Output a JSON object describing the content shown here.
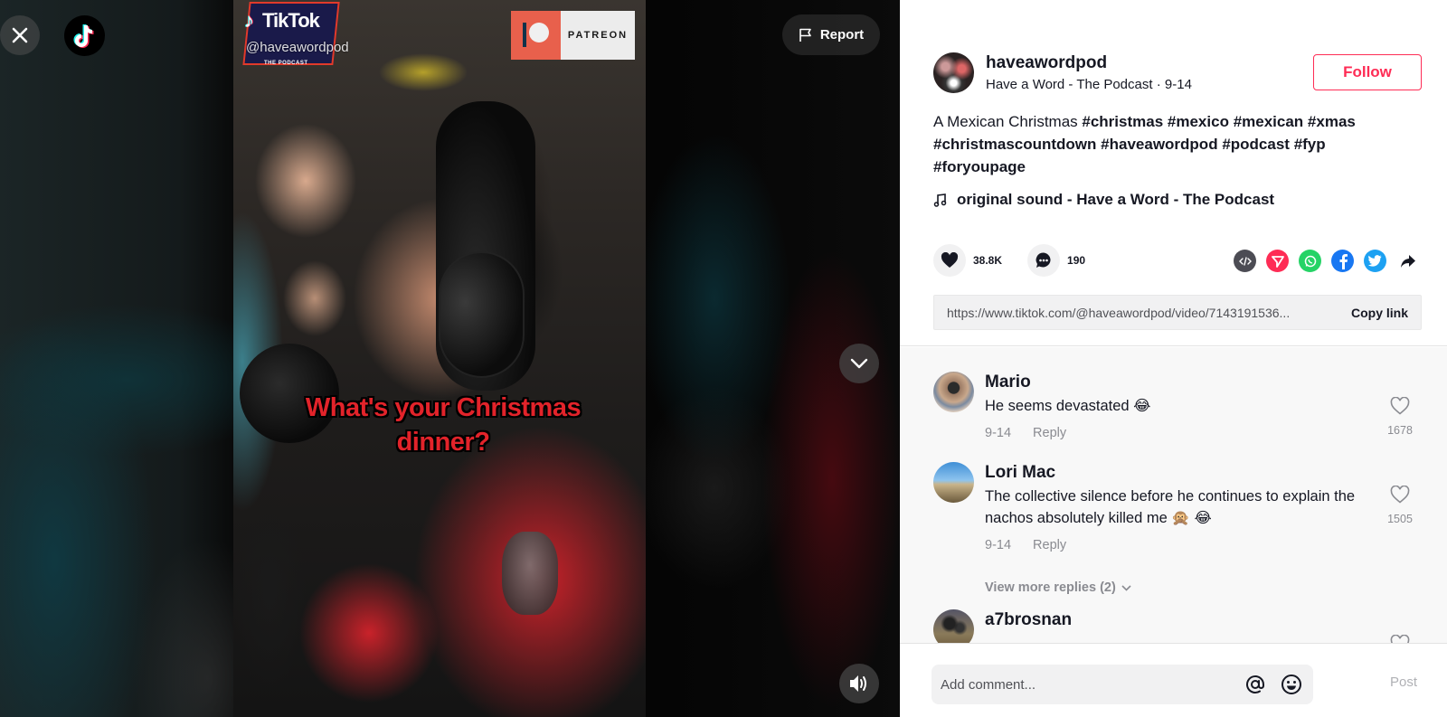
{
  "player": {
    "caption_line1": "What's your Christmas",
    "caption_line2": "dinner?",
    "watermark_brand": "TikTok",
    "watermark_handle": "@haveawordpod",
    "watermark_sub": "THE PODCAST",
    "patreon_label": "PATREON",
    "report_label": "Report",
    "icons": {
      "close": "close-icon",
      "logo": "tiktok-logo-icon",
      "report": "flag-icon",
      "next": "chevron-down-icon",
      "volume": "volume-icon"
    }
  },
  "author": {
    "username": "haveawordpod",
    "nickname": "Have a Word - The Podcast",
    "separator": " · ",
    "date": "9-14",
    "follow_label": "Follow"
  },
  "description": {
    "text": "A Mexican Christmas ",
    "hashtags": [
      "#christmas",
      "#mexico",
      "#mexican",
      "#xmas",
      "#christmascountdown",
      "#haveawordpod",
      "#podcast",
      "#fyp",
      "#foryoupage"
    ]
  },
  "music": {
    "icon": "music-note-icon",
    "title": "original sound - Have a Word - The Podcast"
  },
  "stats": {
    "likes": "38.8K",
    "comments": "190"
  },
  "share": {
    "targets": [
      {
        "name": "embed",
        "color": "#4c4c54"
      },
      {
        "name": "send-to-friends",
        "color": "#fe2c55"
      },
      {
        "name": "whatsapp",
        "color": "#25d366"
      },
      {
        "name": "facebook",
        "color": "#1877f2"
      },
      {
        "name": "twitter",
        "color": "#1da1f2"
      },
      {
        "name": "more",
        "color": "#161823"
      }
    ],
    "link_url": "https://www.tiktok.com/@haveawordpod/video/7143191536...",
    "copy_label": "Copy link"
  },
  "comments": [
    {
      "user": "Mario",
      "text": "He seems devastated 😂",
      "date": "9-14",
      "reply_label": "Reply",
      "likes": "1678"
    },
    {
      "user": "Lori Mac",
      "text": "The collective silence before he continues to explain the nachos absolutely killed me 🙊 😂",
      "date": "9-14",
      "reply_label": "Reply",
      "likes": "1505",
      "view_more": "View more replies (2)"
    },
    {
      "user": "a7brosnan",
      "text": "",
      "date": "",
      "reply_label": "",
      "likes": ""
    }
  ],
  "composer": {
    "placeholder": "Add comment...",
    "post_label": "Post"
  },
  "colors": {
    "accent": "#fe2c55",
    "text_primary": "#161823",
    "text_secondary": "#8a8b91"
  }
}
